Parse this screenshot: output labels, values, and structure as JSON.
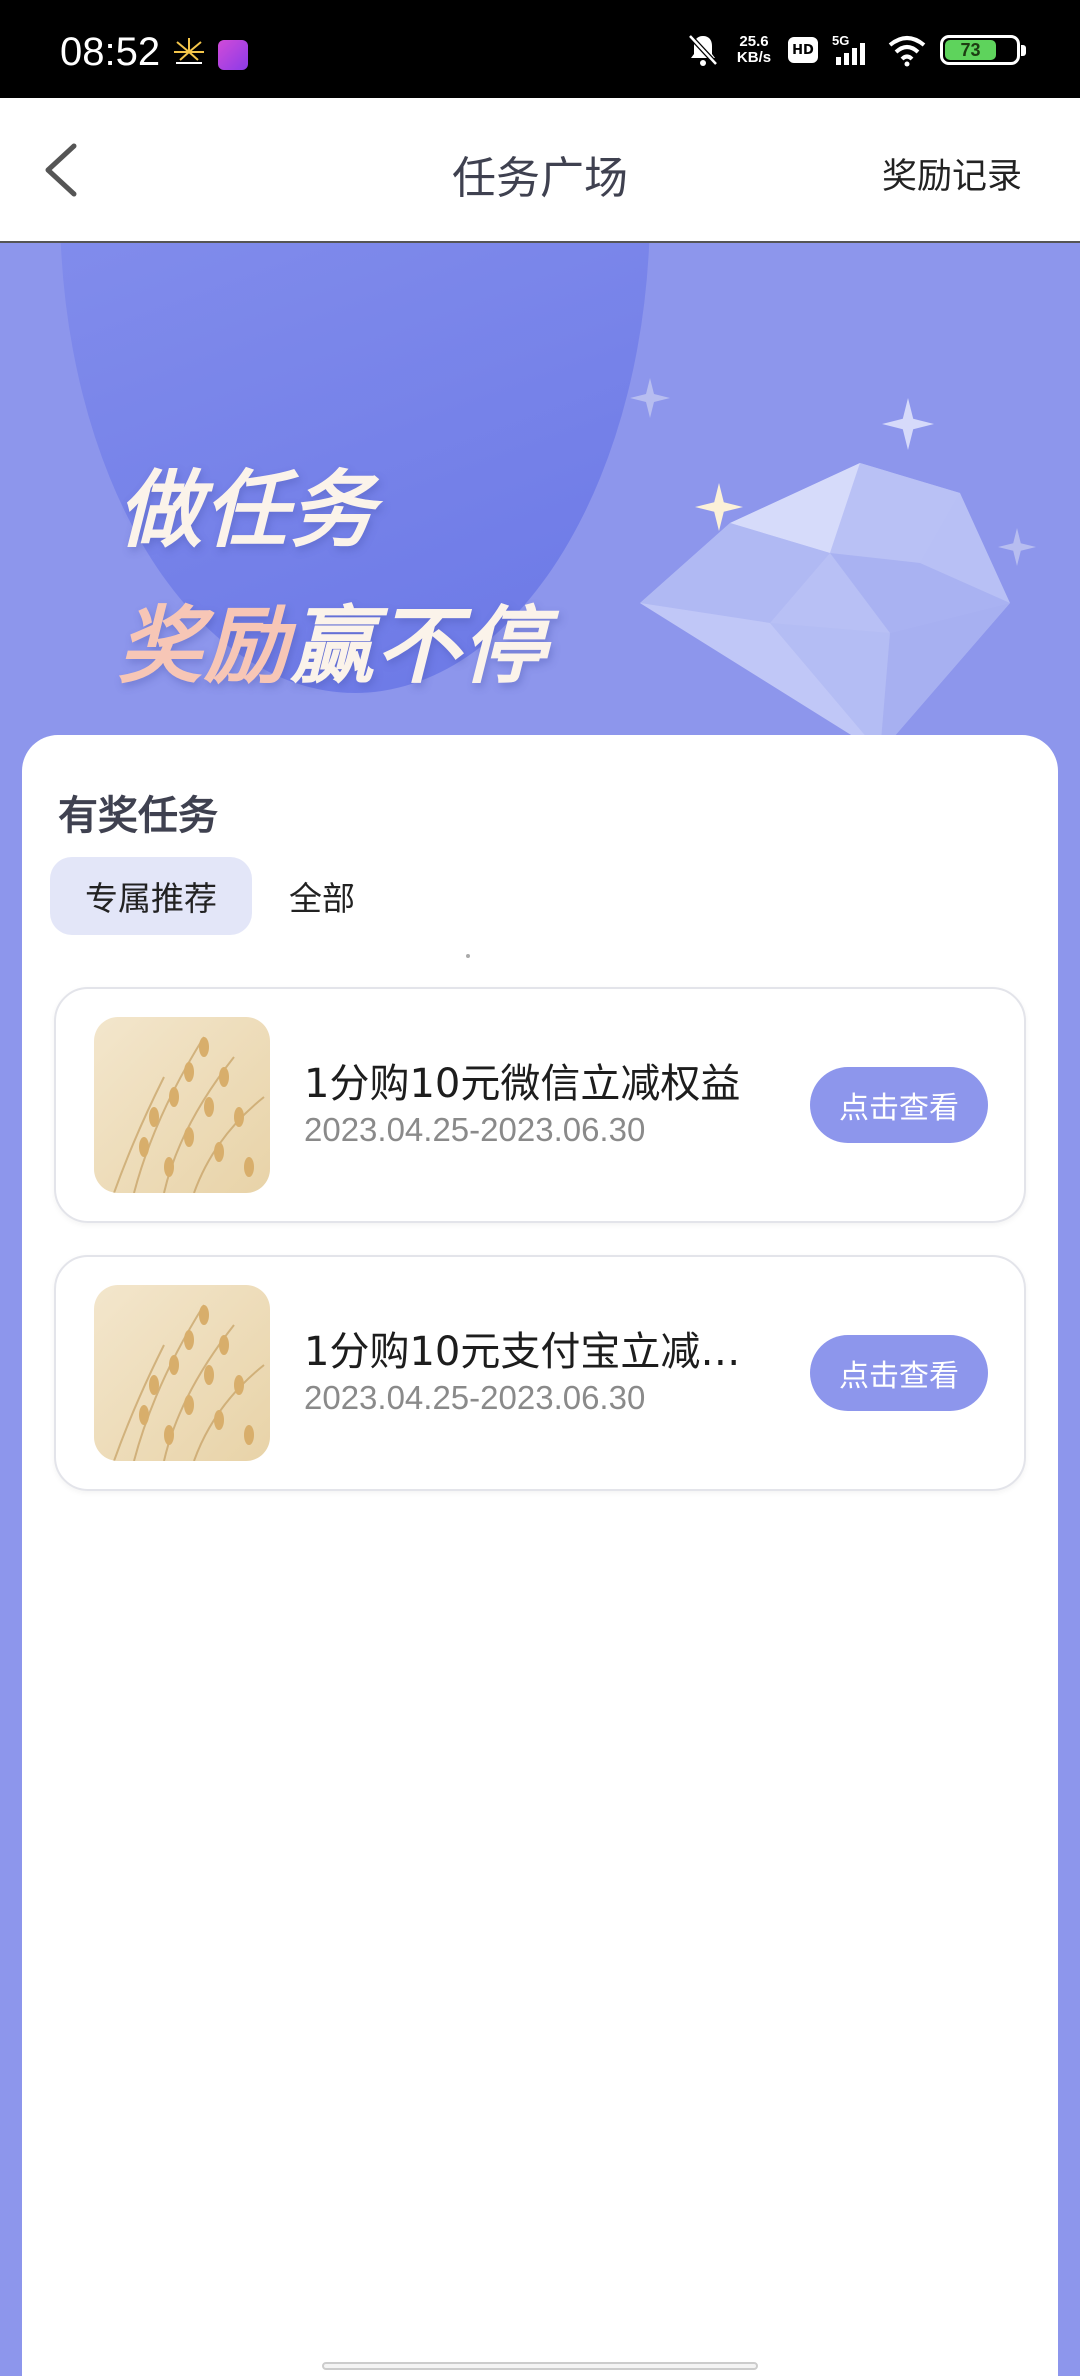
{
  "status_bar": {
    "time": "08:52",
    "net_speed_value": "25.6",
    "net_speed_unit": "KB/s",
    "hd_label": "HD",
    "network_label": "5G",
    "battery_level": "73",
    "icons": [
      "notification-burst-icon",
      "app-badge-icon",
      "mute-icon",
      "signal-icon",
      "wifi-icon",
      "battery-icon"
    ]
  },
  "nav": {
    "title": "任务广场",
    "right_link": "奖励记录",
    "back_icon": "chevron-left-icon"
  },
  "banner": {
    "line1": "做任务",
    "line2_accent": "奖励",
    "line2_rest": "赢不停",
    "colors": {
      "background": "#8d96ec",
      "line1": "#fbf3ea",
      "line2_accent": "#f7c6b6"
    }
  },
  "tasks_section": {
    "title": "有奖任务",
    "tabs": [
      {
        "label": "专属推荐",
        "selected": true
      },
      {
        "label": "全部",
        "selected": false
      }
    ],
    "items": [
      {
        "title": "1分购10元微信立减权益",
        "date_range": "2023.04.25-2023.06.30",
        "button_label": "点击查看"
      },
      {
        "title": "1分购10元支付宝立减…",
        "date_range": "2023.04.25-2023.06.30",
        "button_label": "点击查看"
      }
    ]
  },
  "theme": {
    "accent": "#8d96ec",
    "tab_selected_bg": "#e3e6f8"
  }
}
